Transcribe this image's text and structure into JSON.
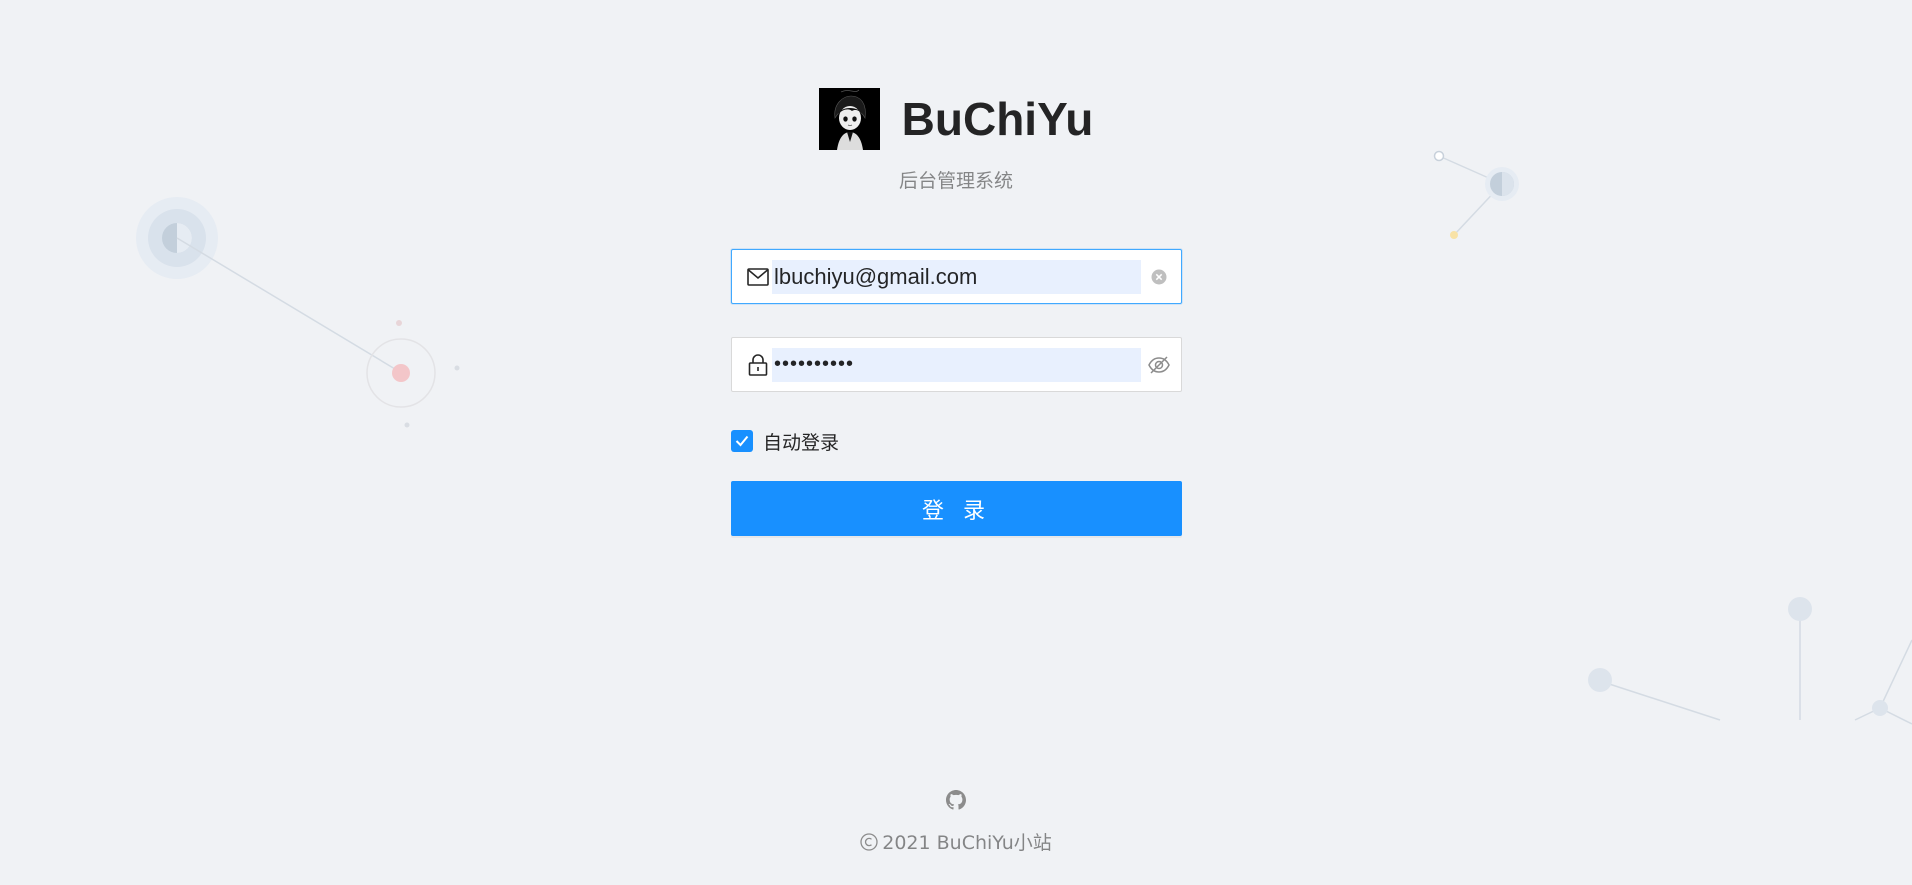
{
  "header": {
    "title": "BuChiYu",
    "subtitle": "后台管理系统"
  },
  "login_form": {
    "email": {
      "value": "lbuchiyu@gmail.com",
      "icon": "mail-icon",
      "suffix_icon": "close-circle-icon"
    },
    "password": {
      "value": "••••••••••",
      "icon": "lock-icon",
      "suffix_icon": "eye-invisible-icon"
    },
    "remember": {
      "label": "自动登录",
      "checked": true
    },
    "submit_label": "登 录"
  },
  "footer": {
    "github_icon": "github-icon",
    "copyright": "2021 BuChiYu小站"
  },
  "colors": {
    "primary": "#1890ff",
    "background": "#f0f2f5",
    "autofill": "#e8f0fe"
  }
}
